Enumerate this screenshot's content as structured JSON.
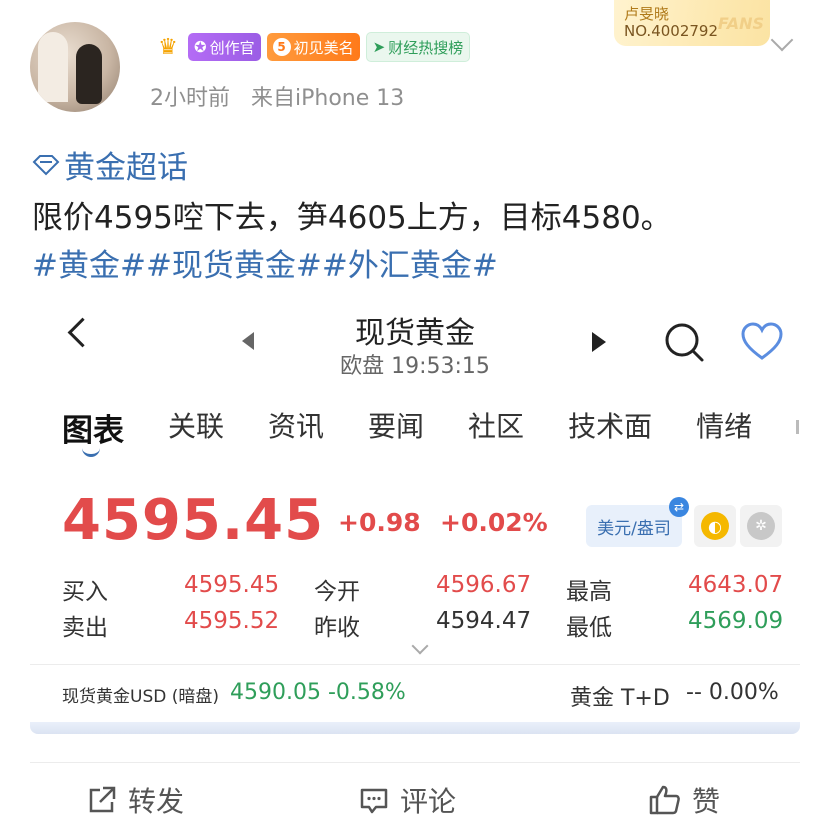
{
  "header": {
    "badges": [
      "crown-badge",
      "创作官",
      "初见美名",
      "财经热搜榜"
    ],
    "meet_level": "5",
    "meta_time": "2小时前",
    "meta_source": "来自iPhone 13",
    "fans_card": {
      "name": "卢旻晓",
      "number": "NO.4002792",
      "tag": "FANS"
    }
  },
  "post": {
    "topic": "黄金超话",
    "text": "限价4595啌下去，笋4605上方，目标4580。",
    "hashtags": "#黄金##现货黄金##外汇黄金#"
  },
  "quote": {
    "title": "现货黄金",
    "subtitle": "欧盘 19:53:15",
    "tabs": [
      "图表",
      "关联",
      "资讯",
      "要闻",
      "社区",
      "技术面",
      "情绪"
    ],
    "price": "4595.45",
    "change": "+0.98",
    "change_pct": "+0.02%",
    "currency_button": "美元/盎司",
    "stats": {
      "buy_label": "买入",
      "buy": "4595.45",
      "sell_label": "卖出",
      "sell": "4595.52",
      "open_label": "今开",
      "open": "4596.67",
      "prev_label": "昨收",
      "prev": "4594.47",
      "high_label": "最高",
      "high": "4643.07",
      "low_label": "最低",
      "low": "4569.09"
    },
    "dark_label": "现货黄金USD (暗盘)",
    "dark_price": "4590.05",
    "dark_change": "-0.58%",
    "td_label": "黄金 T+D",
    "td_value": "-- 0.00%"
  },
  "actions": {
    "forward": "转发",
    "comment": "评论",
    "like": "赞"
  },
  "colors": {
    "up": "#e24b4b",
    "down": "#2f9e5a",
    "link": "#3a6fb0"
  }
}
